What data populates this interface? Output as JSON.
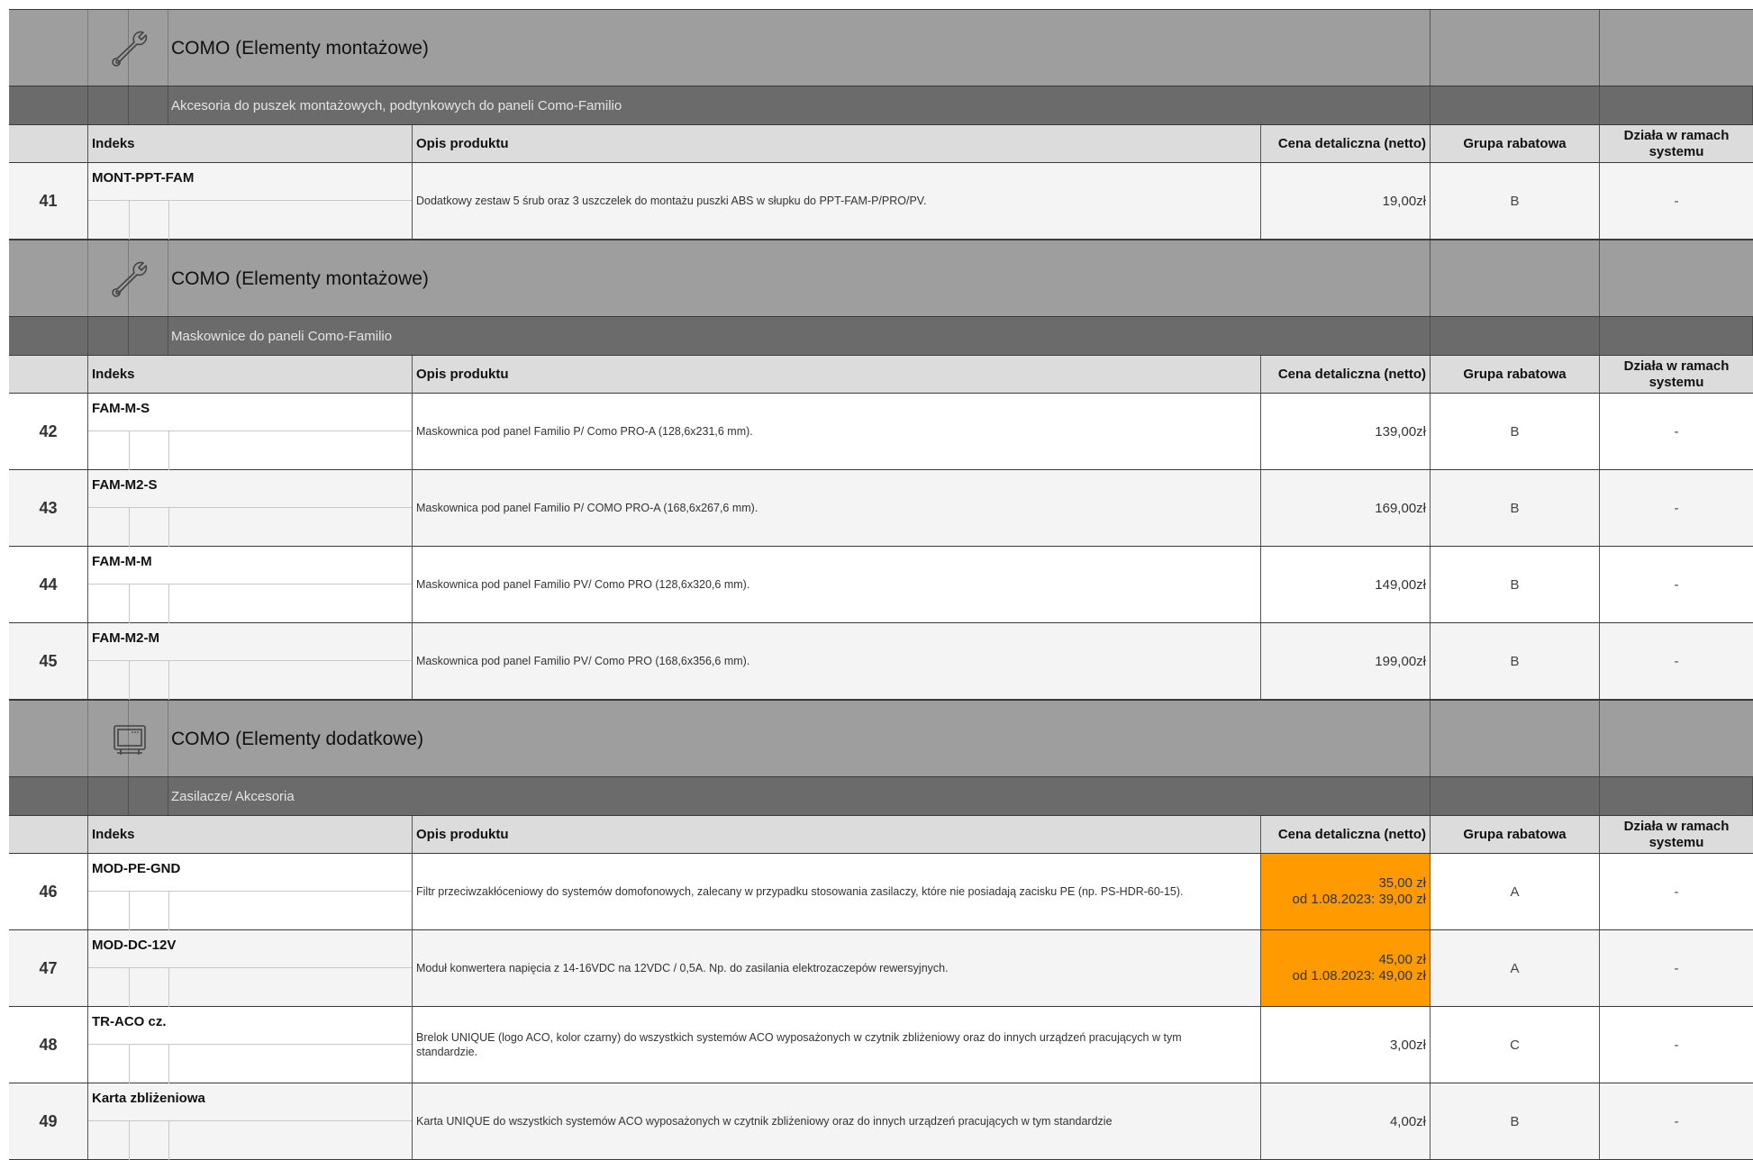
{
  "headers": {
    "indeks": "Indeks",
    "opis": "Opis produktu",
    "cena": "Cena detaliczna (netto)",
    "grupa": "Grupa rabatowa",
    "dziala": "Działa w ramach systemu"
  },
  "sections": [
    {
      "category": "COMO (Elementy montażowe)",
      "icon": "wrench-icon",
      "subcategory": "Akcesoria do puszek montażowych, podtynkowych do paneli Como-Familio",
      "rows": [
        {
          "num": "41",
          "index": "MONT-PPT-FAM",
          "desc": "Dodatkowy zestaw 5 śrub oraz 3 uszczelek do montażu puszki ABS w słupku do PPT-FAM-P/PRO/PV.",
          "price": "19,00zł",
          "price2": "",
          "group": "B",
          "system": "-"
        }
      ]
    },
    {
      "category": "COMO (Elementy montażowe)",
      "icon": "wrench-icon",
      "subcategory": "Maskownice do paneli Como-Familio",
      "rows": [
        {
          "num": "42",
          "index": "FAM-M-S",
          "desc": "Maskownica pod panel Familio P/ Como PRO-A (128,6x231,6 mm).",
          "price": "139,00zł",
          "price2": "",
          "group": "B",
          "system": "-"
        },
        {
          "num": "43",
          "index": "FAM-M2-S",
          "desc": "Maskownica pod panel Familio P/ COMO PRO-A (168,6x267,6 mm).",
          "price": "169,00zł",
          "price2": "",
          "group": "B",
          "system": "-"
        },
        {
          "num": "44",
          "index": "FAM-M-M",
          "desc": "Maskownica pod panel Familio PV/ Como PRO (128,6x320,6 mm).",
          "price": "149,00zł",
          "price2": "",
          "group": "B",
          "system": "-"
        },
        {
          "num": "45",
          "index": "FAM-M2-M",
          "desc": "Maskownica pod panel Familio PV/ Como PRO (168,6x356,6 mm).",
          "price": "199,00zł",
          "price2": "",
          "group": "B",
          "system": "-"
        }
      ]
    },
    {
      "category": "COMO (Elementy dodatkowe)",
      "icon": "monitor-device-icon",
      "subcategory": "Zasilacze/ Akcesoria",
      "rows": [
        {
          "num": "46",
          "index": "MOD-PE-GND",
          "desc": "Filtr przeciwzakłóceniowy do systemów domofonowych, zalecany w przypadku stosowania zasilaczy, które nie posiadają zacisku PE (np. PS-HDR-60-15).",
          "price": "35,00 zł",
          "price2": "od 1.08.2023: 39,00 zł",
          "group": "A",
          "system": "-",
          "highlight": "#ff9a00"
        },
        {
          "num": "47",
          "index": "MOD-DC-12V",
          "desc": "Moduł konwertera napięcia z 14-16VDC na 12VDC / 0,5A. Np. do zasilania elektrozaczepów rewersyjnych.",
          "price": "45,00 zł",
          "price2": "od 1.08.2023: 49,00 zł",
          "group": "A",
          "system": "-",
          "highlight": "#ff9a00"
        },
        {
          "num": "48",
          "index": "TR-ACO cz.",
          "desc": "Brelok UNIQUE (logo ACO, kolor czarny) do wszystkich systemów ACO wyposażonych w czytnik zbliżeniowy oraz do innych urządzeń pracujących w tym standardzie.",
          "price": "3,00zł",
          "price2": "",
          "group": "C",
          "system": "-"
        },
        {
          "num": "49",
          "index": "Karta zbliżeniowa",
          "desc": "Karta UNIQUE do wszystkich systemów ACO wyposażonych w czytnik zbliżeniowy oraz do innych urządzeń pracujących w tym standardzie",
          "price": "4,00zł",
          "price2": "",
          "group": "B",
          "system": "-"
        }
      ]
    }
  ]
}
